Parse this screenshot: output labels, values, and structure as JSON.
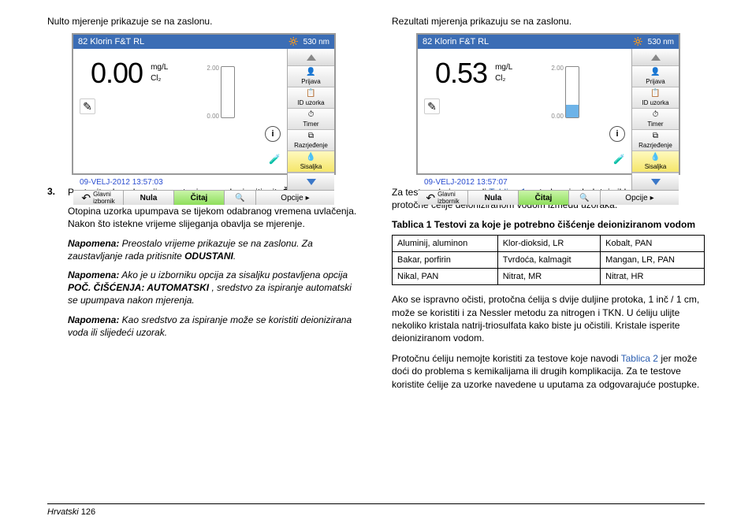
{
  "left": {
    "intro": "Nulto mjerenje prikazuje se na zaslonu.",
    "step_num": "3.",
    "step_line": "Postavite dovodnu cijev u otopinu uzorka i pritisnite",
    "step_bold": "ČITAJ.",
    "step_para": "Otopina uzorka upumpava se tijekom odabranog vremena uvlačenja. Nakon što istekne vrijeme slijeganja obavlja se mjerenje.",
    "note1_label": "Napomena:",
    "note1_body": " Preostalo vrijeme prikazuje se na zaslonu. Za zaustavljanje rada pritisnite ",
    "note1_bold": "ODUSTANI",
    "note1_end": ".",
    "note2_label": "Napomena:",
    "note2_body": " Ako je u izborniku opcija za sisaljku postavljena opcija ",
    "note2_bold": "POČ. ČIŠĆENJA: AUTOMATSKI",
    "note2_end": " , sredstvo za ispiranje automatski se upumpava nakon mjerenja.",
    "note3_label": "Napomena:",
    "note3_body": " Kao sredstvo za ispiranje može se koristiti deionizirana voda ili slijedeći uzorak."
  },
  "right": {
    "intro": "Rezultati mjerenja prikazuju se na zaslonu.",
    "para1_a": "Za testove koje navodi ",
    "para1_link": "Tablica 1",
    "para1_b": " potreban je dodatni ciklus čišćenja protočne ćelije deioniziranom vodom između uzoraka.",
    "table_title": "Tablica 1 Testovi za koje je potrebno čišćenje deioniziranom vodom",
    "table": [
      [
        "Aluminij, aluminon",
        "Klor-dioksid, LR",
        "Kobalt, PAN"
      ],
      [
        "Bakar, porfirin",
        "Tvrdoća, kalmagit",
        "Mangan, LR, PAN"
      ],
      [
        "Nikal, PAN",
        "Nitrat, MR",
        "Nitrat, HR"
      ]
    ],
    "para2": "Ako se ispravno očisti, protočna ćelija s dvije duljine protoka, 1 inč / 1 cm, može se koristiti i za Nessler metodu za nitrogen i TKN. U ćeliju ulijte nekoliko kristala natrij-triosulfata kako biste ju očistili. Kristale isperite deioniziranom vodom.",
    "para3_a": "Protočnu ćeliju nemojte koristiti za testove koje navodi ",
    "para3_link": "Tablica 2",
    "para3_b": " jer može doći do problema s kemikalijama ili drugih komplikacija. Za te testove koristite ćelije za uzorke navedene u uputama za odgovarajuće postupke."
  },
  "device": {
    "title": "82 Klorin F&T RL",
    "nm": "530 nm",
    "unit": "mg/L",
    "formula": "Cl₂",
    "gauge_hi": "2.00",
    "gauge_lo": "0.00",
    "side": {
      "prijava": "Prijava",
      "id": "ID uzorka",
      "timer": "Timer",
      "razrj": "Razrjeđenje",
      "sisaljka": "Sisaljka"
    },
    "footer": {
      "home1": "Glavni",
      "home2": "izbornik",
      "nula": "Nula",
      "citaj": "Čitaj",
      "opcije": "Opcije"
    },
    "left": {
      "reading": "0.00",
      "datetime": "09-VELJ-2012  13:57:03",
      "fill_pct": 0
    },
    "right": {
      "reading": "0.53",
      "datetime": "09-VELJ-2012  13:57:07",
      "fill_pct": 25
    }
  },
  "footer": {
    "lang": "Hrvatski",
    "page": "126"
  }
}
